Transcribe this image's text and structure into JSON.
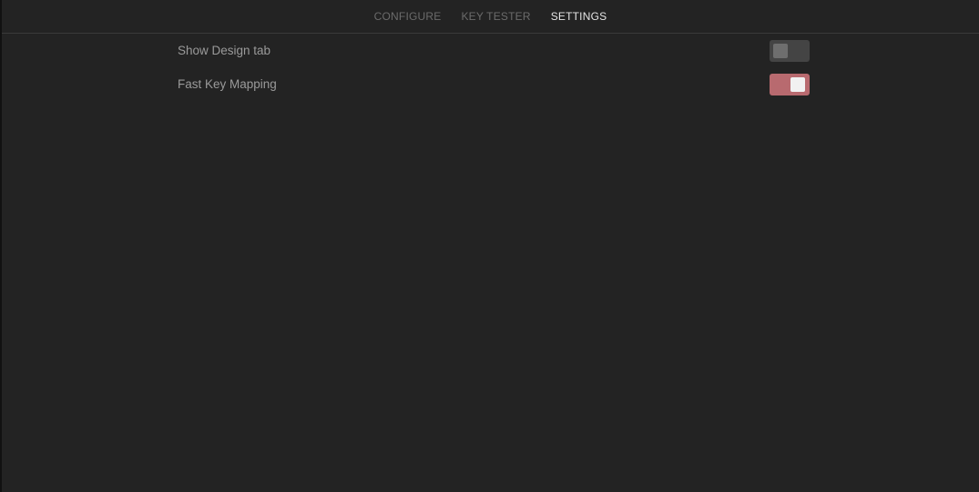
{
  "tabs": [
    {
      "label": "CONFIGURE",
      "active": false
    },
    {
      "label": "KEY TESTER",
      "active": false
    },
    {
      "label": "SETTINGS",
      "active": true
    }
  ],
  "settings": [
    {
      "label": "Show Design tab",
      "enabled": false
    },
    {
      "label": "Fast Key Mapping",
      "enabled": true
    }
  ],
  "colors": {
    "background": "#232323",
    "tab_inactive": "#6b6b6b",
    "tab_active": "#e4e4e4",
    "toggle_off": "#444444",
    "toggle_on": "#b86a6f"
  }
}
